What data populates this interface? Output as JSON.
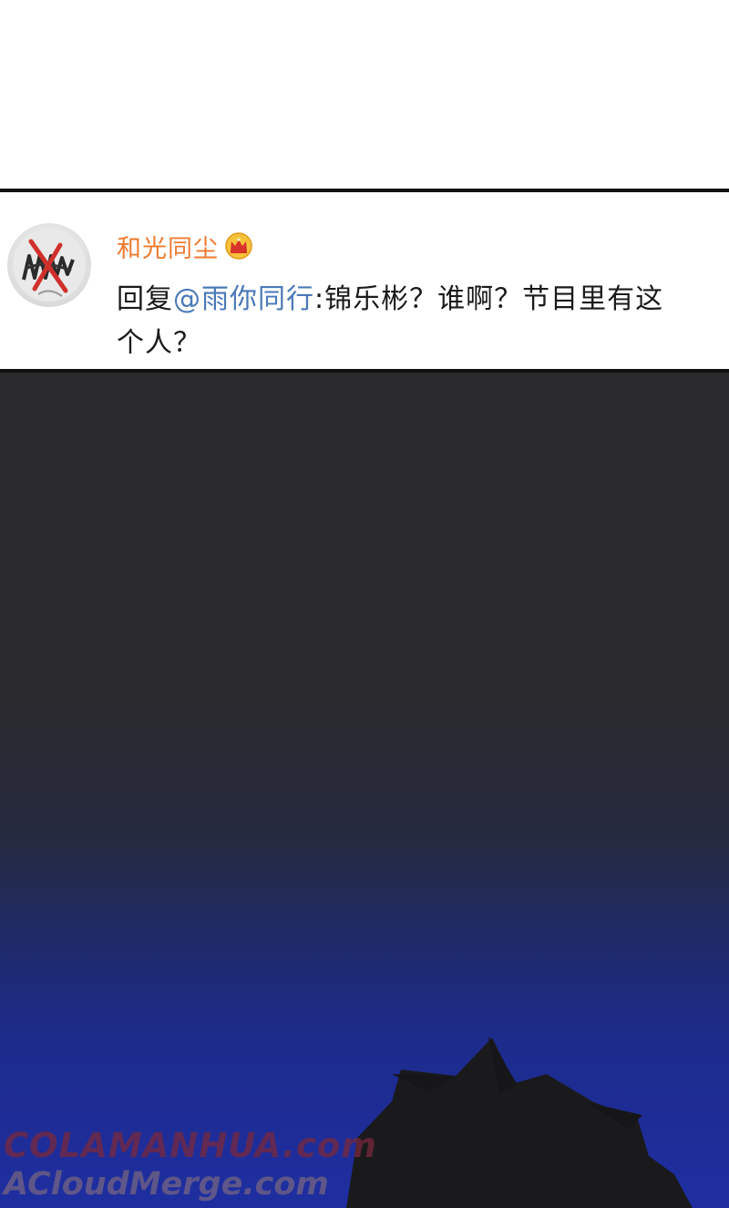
{
  "comment": {
    "username": "和光同尘",
    "reply_prefix": "回复",
    "mention": "@雨你同行",
    "body_line1": ":锦乐彬？谁啊？节目里有这",
    "body_line2": "个人？"
  },
  "icons": {
    "avatar": "scribbled-avatar",
    "badge": "crown-icon"
  },
  "watermarks": {
    "line1": "COLAMANHUA.com",
    "line2": "ACloudMerge.com"
  },
  "colors": {
    "username": "#ee7a2f",
    "mention": "#4a79b8",
    "panel_border": "#111111",
    "scene_top": "#2b2b2e",
    "scene_bottom": "#1e2ea0"
  }
}
